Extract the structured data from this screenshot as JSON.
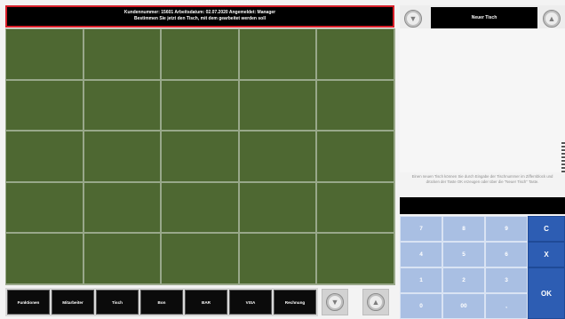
{
  "header": {
    "line1": "Kundennummer: 15601 Arbeitsdatum: 02.07.2020 Angemeldet: Manager",
    "line2": "Bestimmen Sie jetzt den Tisch, mit dem gearbeitet werden soll"
  },
  "function_bar": [
    "Funktionen",
    "Mitarbeiter",
    "Tisch",
    "Bon",
    "BAR",
    "VISA",
    "Rechnung"
  ],
  "right_panel": {
    "new_table_label": "Neuer Tisch",
    "hint": "Einen neuen Tisch können Sie durch Eingabe der Tischnummer im Ziffernblock und drücken der Taste OK erzeugen oder über die \"Neuer Tisch\" Taste."
  },
  "keypad": {
    "keys": [
      "7",
      "8",
      "9",
      "C",
      "4",
      "5",
      "6",
      "X",
      "1",
      "2",
      "3",
      "OK",
      "0",
      "00",
      ","
    ]
  },
  "icons": {
    "scroll_down": "chevron-down-circle-icon",
    "scroll_up": "chevron-up-circle-icon"
  },
  "colors": {
    "table_grid": "#4e6832",
    "keypad_digit": "#a9bfe3",
    "keypad_control": "#2d5db3",
    "header_border": "#d8202a"
  }
}
